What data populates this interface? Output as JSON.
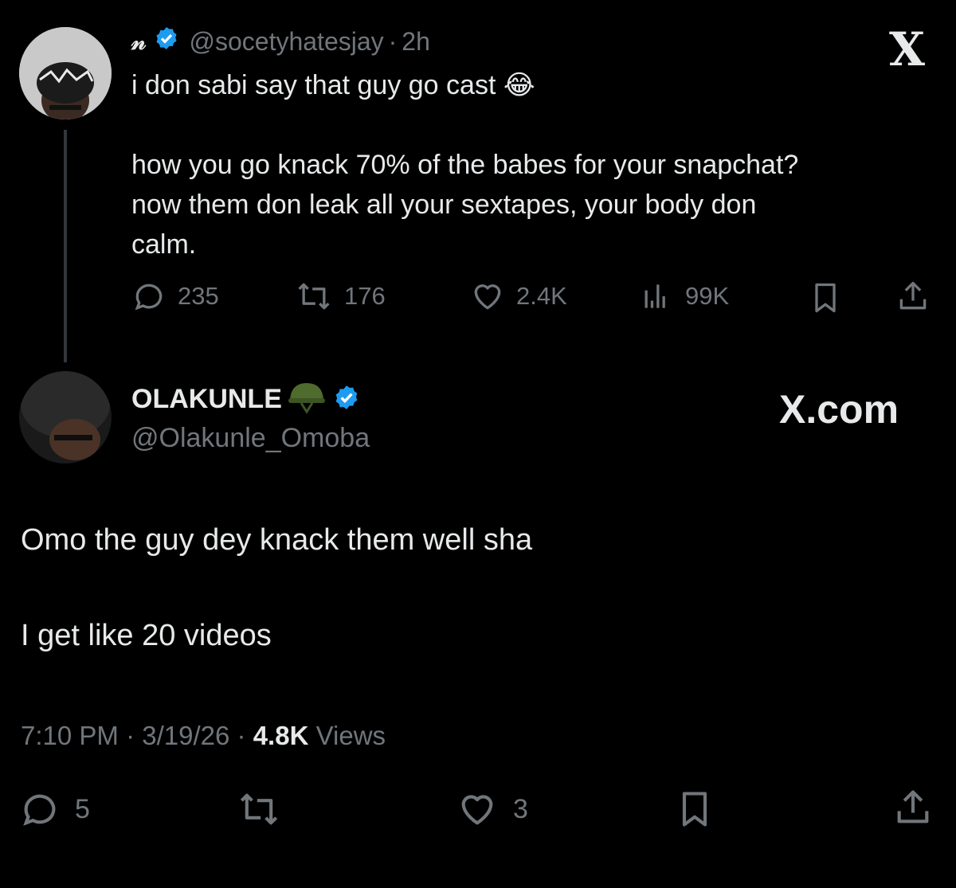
{
  "parent_tweet": {
    "display_name": "𝓃",
    "handle": "@socetyhatesjay",
    "time": "2h",
    "line1": "i don sabi say that guy go cast",
    "emoji": "😂",
    "body_line1": "how you go knack 70% of the babes for your snapchat?",
    "body_line2": "now them don leak all your sextapes, your body don",
    "body_line3": "calm.",
    "replies": "235",
    "retweets": "176",
    "likes": "2.4K",
    "views": "99K"
  },
  "reply_tweet": {
    "display_name": "OLAKUNLE",
    "handle": "@Olakunle_Omoba",
    "text_line1": "Omo the guy dey knack them well sha",
    "text_line2": "I get like 20 videos",
    "time": "7:10 PM",
    "date": "3/19/26",
    "views_count": "4.8K",
    "views_label": "Views",
    "replies": "5",
    "likes": "3"
  },
  "brand": {
    "x_logo": "X",
    "x_com": "X.com"
  },
  "colors": {
    "background": "#000000",
    "text": "#e7e9ea",
    "muted": "#71767b",
    "verified": "#1d9bf0"
  }
}
